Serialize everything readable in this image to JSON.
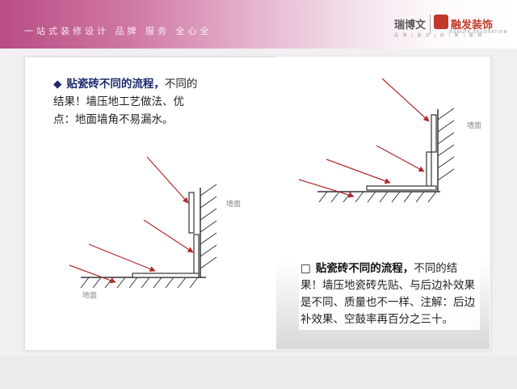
{
  "header": {
    "slogan": "一站式装修设计 品牌 服务 全心全",
    "brand_name": "瑞博文",
    "company": "融发装饰",
    "company_en": "RONGFA DECORATION",
    "tagline": "品 質 | 設 計 | 創 | 新 | 服 務"
  },
  "section_1": {
    "lead": "贴瓷砖不同的流程，",
    "body": "不同的结果！墙压地工艺做法、优点：地面墙角不易漏水。",
    "bullet": "◆"
  },
  "section_2": {
    "lead": "贴瓷砖不同的流程，",
    "body": "不同的结果！墙压地瓷砖先贴、与后边补效果是不同、质量也不一样、注解：后边补效果、空鼓率再百分之三十。",
    "bullet": "□"
  },
  "diagram_1": {
    "wall_label": "墙面",
    "floor_label": "地面"
  },
  "diagram_2": {
    "wall_label": "墙面"
  },
  "colors": {
    "arrow": "#b02a2a",
    "accent": "#c0392b",
    "lead_blue": "#1d2a6e"
  }
}
